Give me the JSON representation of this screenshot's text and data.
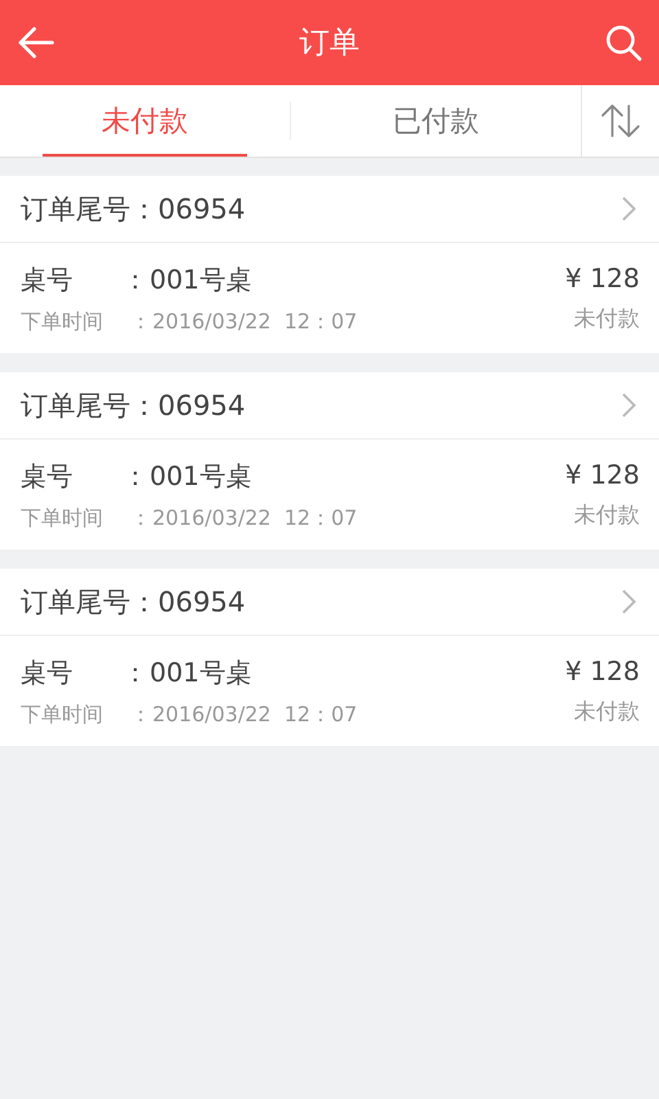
{
  "header": {
    "title": "订单"
  },
  "tabs": [
    {
      "label": "未付款",
      "selected": true
    },
    {
      "label": "已付款",
      "selected": false
    }
  ],
  "orders": [
    {
      "title": "订单尾号：06954",
      "table_label": "桌号",
      "table_sep": "：",
      "table_value": "001号桌",
      "time_label": "下单时间",
      "time_sep": "：",
      "time_value": "2016/03/22  12：07",
      "price": "¥ 128",
      "status": "未付款"
    },
    {
      "title": "订单尾号：06954",
      "table_label": "桌号",
      "table_sep": "：",
      "table_value": "001号桌",
      "time_label": "下单时间",
      "time_sep": "：",
      "time_value": "2016/03/22  12：07",
      "price": "¥ 128",
      "status": "未付款"
    },
    {
      "title": "订单尾号：06954",
      "table_label": "桌号",
      "table_sep": "：",
      "table_value": "001号桌",
      "time_label": "下单时间",
      "time_sep": "：",
      "time_value": "2016/03/22  12：07",
      "price": "¥ 128",
      "status": "未付款"
    }
  ]
}
